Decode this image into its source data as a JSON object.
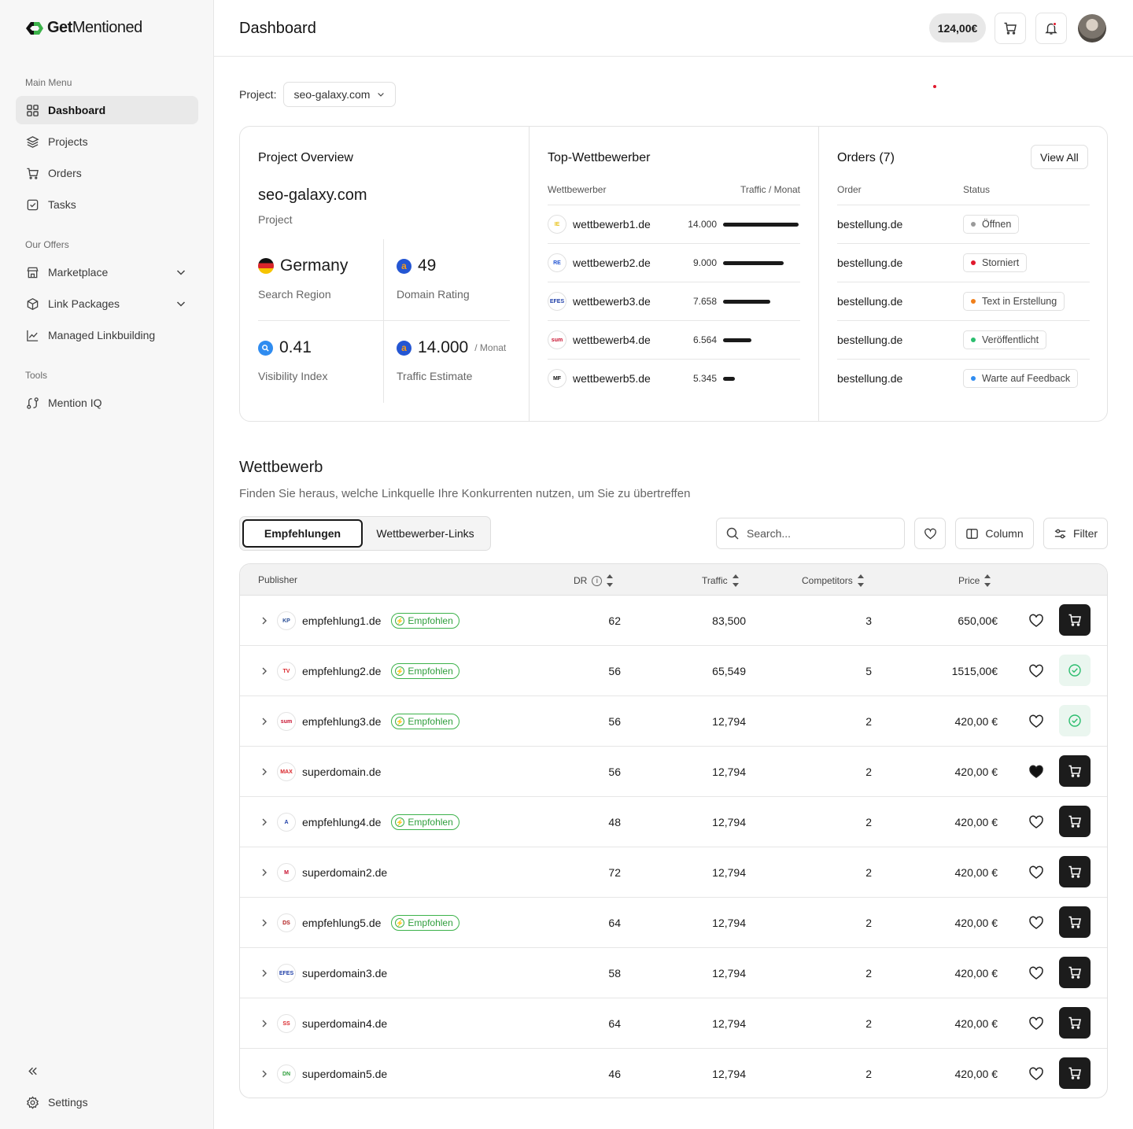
{
  "brand": {
    "name_bold": "Get",
    "name_light": "Mentioned"
  },
  "sidebar": {
    "main_menu_label": "Main Menu",
    "offers_label": "Our Offers",
    "tools_label": "Tools",
    "items": [
      {
        "label": "Dashboard",
        "icon": "grid-icon"
      },
      {
        "label": "Projects",
        "icon": "layers-icon"
      },
      {
        "label": "Orders",
        "icon": "cart-icon"
      },
      {
        "label": "Tasks",
        "icon": "checkbox-icon"
      },
      {
        "label": "Marketplace",
        "icon": "store-icon"
      },
      {
        "label": "Link Packages",
        "icon": "package-icon"
      },
      {
        "label": "Managed Linkbuilding",
        "icon": "chart-line-icon"
      },
      {
        "label": "Mention IQ",
        "icon": "route-icon"
      }
    ],
    "settings_label": "Settings"
  },
  "header": {
    "title": "Dashboard",
    "balance": "124,00€"
  },
  "project_selector": {
    "label": "Project:",
    "value": "seo-galaxy.com"
  },
  "overview": {
    "title": "Project Overview",
    "domain": "seo-galaxy.com",
    "sub": "Project",
    "region_value": "Germany",
    "region_label": "Search Region",
    "dr_value": "49",
    "dr_label": "Domain Rating",
    "vis_value": "0.41",
    "vis_label": "Visibility Index",
    "traffic_value": "14.000",
    "traffic_unit": "/ Monat",
    "traffic_label": "Traffic Estimate"
  },
  "competitors": {
    "title": "Top-Wettbewerber",
    "col_name": "Wettbewerber",
    "col_traffic": "Traffic / Monat",
    "rows": [
      {
        "name": "wettbewerb1.de",
        "traffic": "14.000",
        "share": 1.0
      },
      {
        "name": "wettbewerb2.de",
        "traffic": "9.000",
        "share": 0.8
      },
      {
        "name": "wettbewerb3.de",
        "traffic": "7.658",
        "share": 0.62
      },
      {
        "name": "wettbewerb4.de",
        "traffic": "6.564",
        "share": 0.38
      },
      {
        "name": "wettbewerb5.de",
        "traffic": "5.345",
        "share": 0.16
      }
    ]
  },
  "orders": {
    "title": "Orders (7)",
    "view_all": "View All",
    "col_order": "Order",
    "col_status": "Status",
    "rows": [
      {
        "name": "bestellung.de",
        "status": "Öffnen",
        "color": "#9a9a9a"
      },
      {
        "name": "bestellung.de",
        "status": "Storniert",
        "color": "#e0192d"
      },
      {
        "name": "bestellung.de",
        "status": "Text in Erstellung",
        "color": "#f07f1a"
      },
      {
        "name": "bestellung.de",
        "status": "Veröffentlicht",
        "color": "#2bbd6e"
      },
      {
        "name": "bestellung.de",
        "status": "Warte auf Feedback",
        "color": "#2f8cf0"
      }
    ]
  },
  "wettbewerb": {
    "title": "Wettbewerb",
    "subtitle": "Finden Sie heraus, welche Linkquelle Ihre Konkurrenten nutzen, um Sie zu übertreffen",
    "tab_active": "Empfehlungen",
    "tab_inactive": "Wettbewerber-Links",
    "search_placeholder": "Search...",
    "column_label": "Column",
    "filter_label": "Filter"
  },
  "table": {
    "headers": {
      "publisher": "Publisher",
      "dr": "DR",
      "traffic": "Traffic",
      "competitors": "Competitors",
      "price": "Price"
    },
    "badge_label": "Empfohlen",
    "rows": [
      {
        "name": "empfehlung1.de",
        "badge": true,
        "dr": "62",
        "traffic": "83,500",
        "competitors": "3",
        "price": "650,00€",
        "fav": false,
        "in_cart": false,
        "logo": "KP",
        "logo_color": "#2a4e96"
      },
      {
        "name": "empfehlung2.de",
        "badge": true,
        "dr": "56",
        "traffic": "65,549",
        "competitors": "5",
        "price": "1515,00€",
        "fav": false,
        "in_cart": true,
        "logo": "TV",
        "logo_color": "#d9252a"
      },
      {
        "name": "empfehlung3.de",
        "badge": true,
        "dr": "56",
        "traffic": "12,794",
        "competitors": "2",
        "price": "420,00 €",
        "fav": false,
        "in_cart": true,
        "logo": "sum",
        "logo_color": "#c8102e"
      },
      {
        "name": "superdomain.de",
        "badge": false,
        "dr": "56",
        "traffic": "12,794",
        "competitors": "2",
        "price": "420,00 €",
        "fav": true,
        "in_cart": false,
        "logo": "MAX",
        "logo_color": "#d9252a"
      },
      {
        "name": "empfehlung4.de",
        "badge": true,
        "dr": "48",
        "traffic": "12,794",
        "competitors": "2",
        "price": "420,00 €",
        "fav": false,
        "in_cart": false,
        "logo": "A",
        "logo_color": "#1f3fa8"
      },
      {
        "name": "superdomain2.de",
        "badge": false,
        "dr": "72",
        "traffic": "12,794",
        "competitors": "2",
        "price": "420,00 €",
        "fav": false,
        "in_cart": false,
        "logo": "M",
        "logo_color": "#c8102e"
      },
      {
        "name": "empfehlung5.de",
        "badge": true,
        "dr": "64",
        "traffic": "12,794",
        "competitors": "2",
        "price": "420,00 €",
        "fav": false,
        "in_cart": false,
        "logo": "DS",
        "logo_color": "#b01c1c"
      },
      {
        "name": "superdomain3.de",
        "badge": false,
        "dr": "58",
        "traffic": "12,794",
        "competitors": "2",
        "price": "420,00 €",
        "fav": false,
        "in_cart": false,
        "logo": "EFES",
        "logo_color": "#1f3fa8"
      },
      {
        "name": "superdomain4.de",
        "badge": false,
        "dr": "64",
        "traffic": "12,794",
        "competitors": "2",
        "price": "420,00 €",
        "fav": false,
        "in_cart": false,
        "logo": "SS",
        "logo_color": "#d9252a"
      },
      {
        "name": "superdomain5.de",
        "badge": false,
        "dr": "46",
        "traffic": "12,794",
        "competitors": "2",
        "price": "420,00 €",
        "fav": false,
        "in_cart": false,
        "logo": "DN",
        "logo_color": "#2f9e3c"
      }
    ]
  }
}
